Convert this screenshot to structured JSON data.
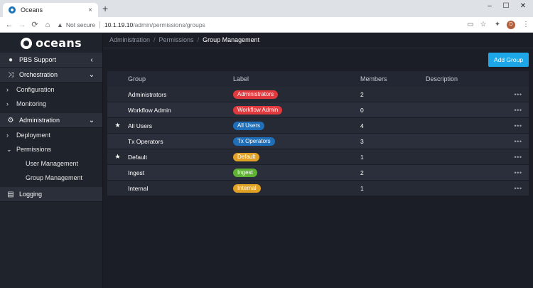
{
  "browser": {
    "tab_title": "Oceans",
    "tab_close": "×",
    "new_tab": "+",
    "window_controls": [
      "–",
      "☐",
      "✕"
    ],
    "nav": {
      "back": "←",
      "forward": "→",
      "reload": "⟳",
      "home": "⌂"
    },
    "not_secure": "Not secure",
    "url_host": "10.1.19.10",
    "url_path": "/admin/permissions/groups",
    "profile_initial": "D",
    "icons": [
      "cast-icon",
      "star-icon",
      "extensions-icon",
      "menu-icon"
    ]
  },
  "sidebar": {
    "logo_text": "oceans",
    "sections": [
      {
        "label": "PBS Support",
        "icon": "user-icon",
        "chevron": "‹"
      },
      {
        "label": "Orchestration",
        "icon": "shuffle-icon",
        "chevron": "⌄"
      }
    ],
    "orchestration_items": [
      {
        "label": "Configuration",
        "chevron": "›"
      },
      {
        "label": "Monitoring",
        "chevron": "›"
      }
    ],
    "admin_section": {
      "label": "Administration",
      "icon": "gear-icon",
      "chevron": "⌄"
    },
    "admin_items": [
      {
        "label": "Deployment",
        "chevron": "›"
      },
      {
        "label": "Permissions",
        "chevron": "⌄"
      }
    ],
    "permission_subitems": [
      "User Management",
      "Group Management"
    ],
    "logging": {
      "label": "Logging",
      "icon": "log-icon"
    }
  },
  "main": {
    "breadcrumb": [
      "Administration",
      "Permissions",
      "Group Management"
    ],
    "breadcrumb_sep": "/",
    "add_button": "Add Group",
    "columns": [
      "Group",
      "Label",
      "Members",
      "Description"
    ],
    "rows": [
      {
        "starred": false,
        "group": "Administrators",
        "label": "Administrators",
        "label_color": "#e0393e",
        "members": "2",
        "description": "",
        "menu": "•••"
      },
      {
        "starred": false,
        "group": "Workflow Admin",
        "label": "Workflow Admin",
        "label_color": "#e0393e",
        "members": "0",
        "description": "",
        "menu": "•••"
      },
      {
        "starred": true,
        "group": "All Users",
        "label": "All Users",
        "label_color": "#1e6fb8",
        "members": "4",
        "description": "",
        "menu": "•••"
      },
      {
        "starred": false,
        "group": "Tx Operators",
        "label": "Tx Operators",
        "label_color": "#1e6fb8",
        "members": "3",
        "description": "",
        "menu": "•••"
      },
      {
        "starred": true,
        "group": "Default",
        "label": "Default",
        "label_color": "#e0a125",
        "members": "1",
        "description": "",
        "menu": "•••"
      },
      {
        "starred": false,
        "group": "Ingest",
        "label": "Ingest",
        "label_color": "#5fb233",
        "members": "2",
        "description": "",
        "menu": "•••"
      },
      {
        "starred": false,
        "group": "Internal",
        "label": "Internal",
        "label_color": "#e0a125",
        "members": "1",
        "description": "",
        "menu": "•••"
      }
    ],
    "star_glyph": "★"
  }
}
